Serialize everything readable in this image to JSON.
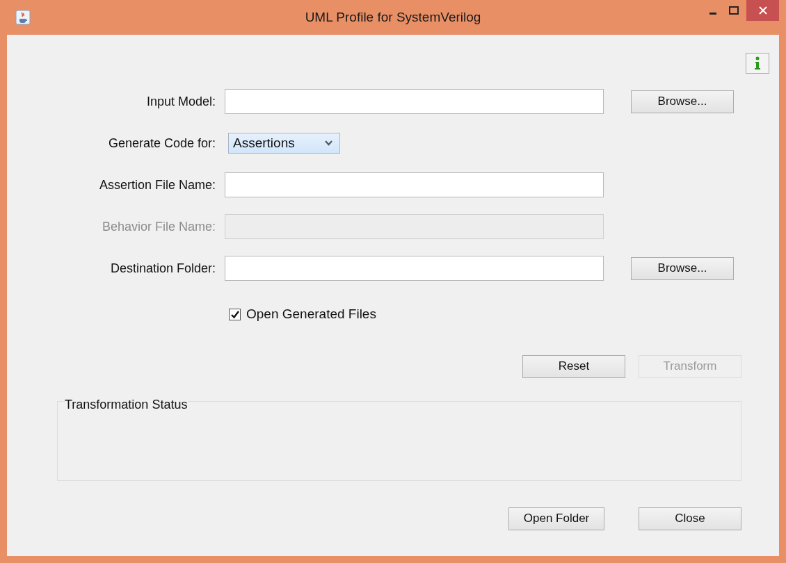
{
  "window": {
    "title": "UML Profile for SystemVerilog"
  },
  "form": {
    "rows": [
      {
        "kind": "text",
        "label": "Input Model:",
        "disabled": false,
        "button": "Browse..."
      },
      {
        "kind": "select",
        "label": "Generate Code for:",
        "value": "Assertions"
      },
      {
        "kind": "text",
        "label": "Assertion File Name:",
        "disabled": false
      },
      {
        "kind": "text",
        "label": "Behavior File Name:",
        "disabled": true
      },
      {
        "kind": "text",
        "label": "Destination Folder:",
        "disabled": false,
        "button": "Browse..."
      }
    ]
  },
  "open_generated_files": {
    "label": "Open Generated Files",
    "checked": true
  },
  "actions": [
    {
      "label": "Reset",
      "disabled": false
    },
    {
      "label": "Transform",
      "disabled": true
    }
  ],
  "status_group": {
    "title": "Transformation Status"
  },
  "footer_buttons": [
    {
      "label": "Open Folder"
    },
    {
      "label": "Close"
    }
  ]
}
